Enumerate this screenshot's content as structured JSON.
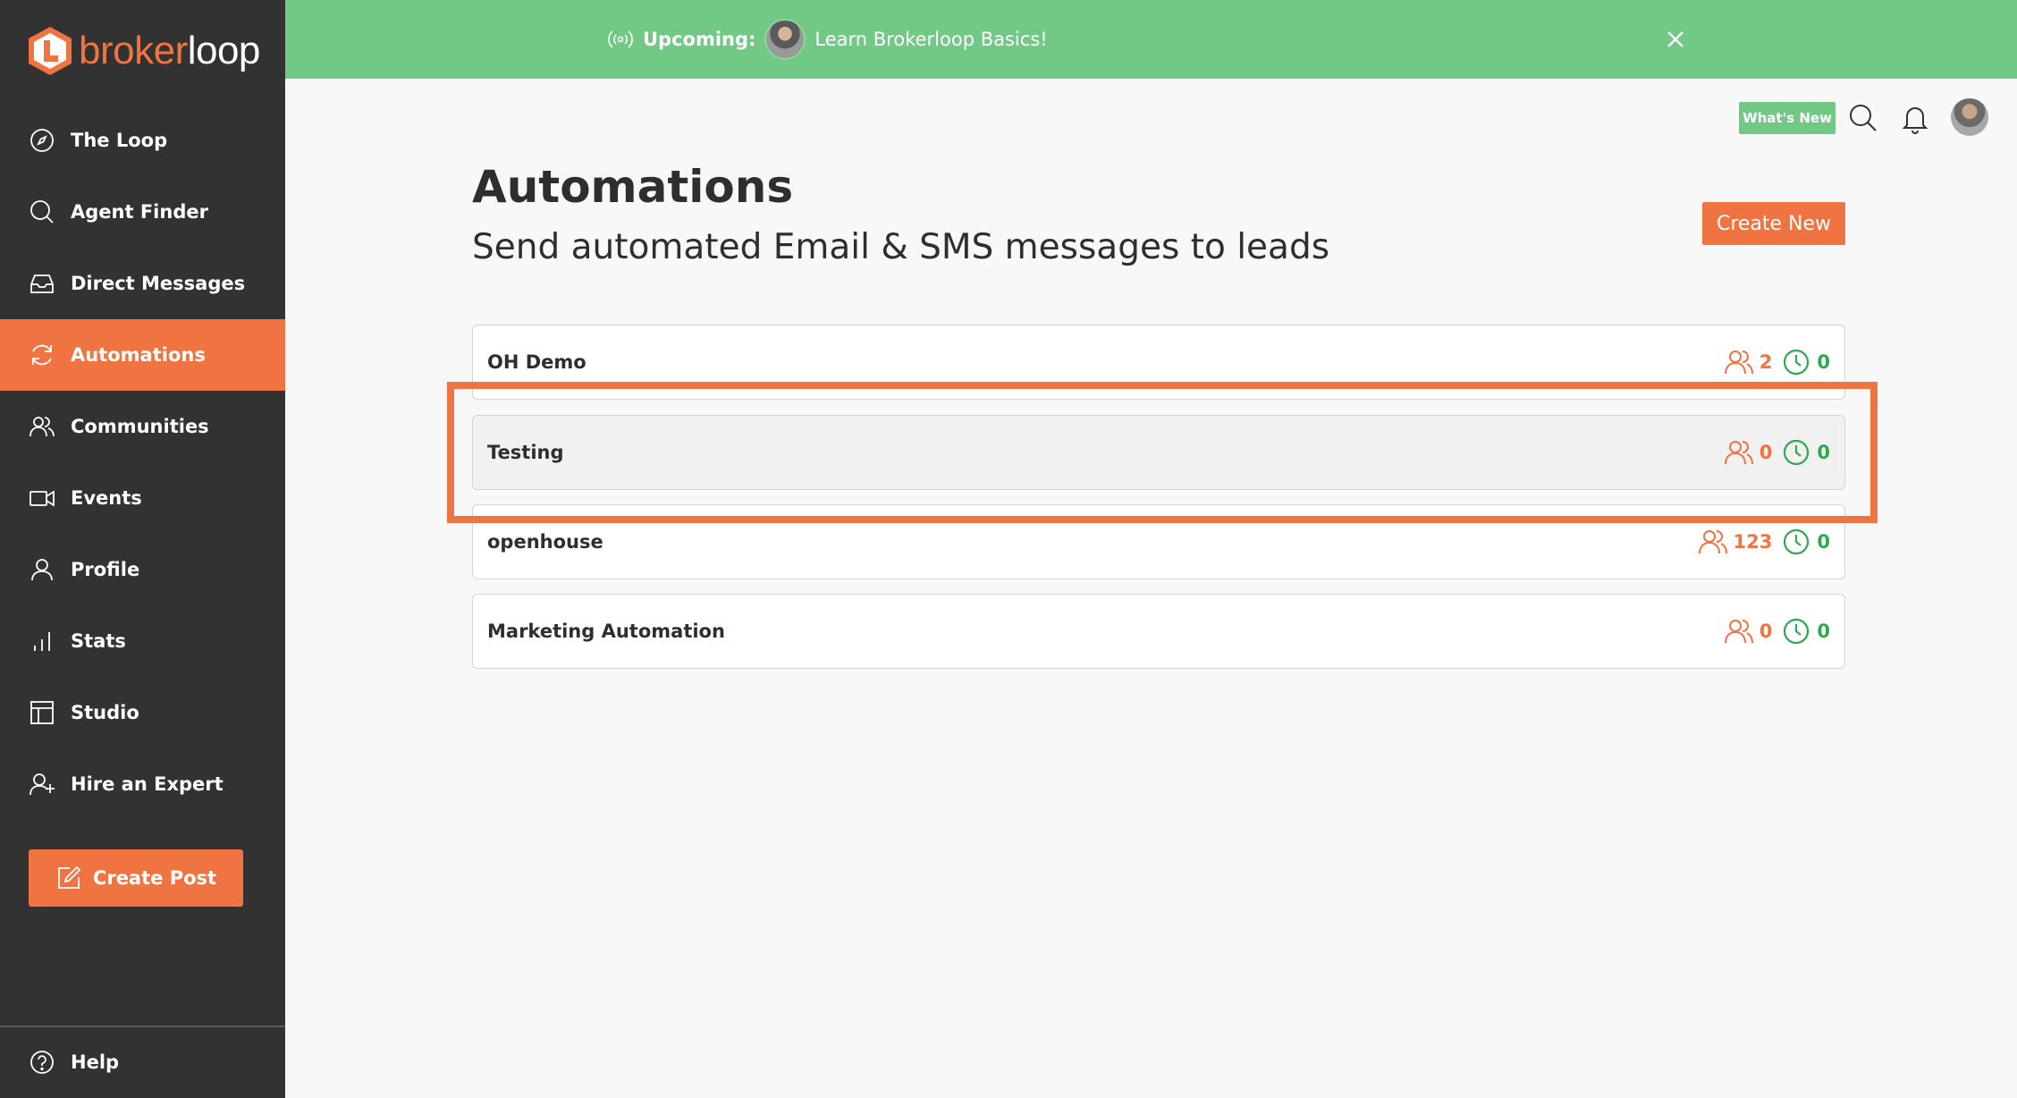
{
  "brand": {
    "part1": "broker",
    "part2": "loop",
    "accent": "#f07342"
  },
  "sidebar": {
    "items": [
      {
        "label": "The Loop",
        "icon": "compass-icon"
      },
      {
        "label": "Agent Finder",
        "icon": "search-icon"
      },
      {
        "label": "Direct Messages",
        "icon": "inbox-icon"
      },
      {
        "label": "Automations",
        "icon": "refresh-icon",
        "active": true
      },
      {
        "label": "Communities",
        "icon": "users-icon"
      },
      {
        "label": "Events",
        "icon": "video-icon"
      },
      {
        "label": "Profile",
        "icon": "user-icon"
      },
      {
        "label": "Stats",
        "icon": "bar-chart-icon"
      },
      {
        "label": "Studio",
        "icon": "layout-icon"
      },
      {
        "label": "Hire an Expert",
        "icon": "user-plus-icon"
      }
    ],
    "create_post_label": "Create Post",
    "help_label": "Help"
  },
  "banner": {
    "upcoming_label": "Upcoming:",
    "title": "Learn Brokerloop Basics!",
    "color": "#72c885"
  },
  "topbar": {
    "whats_new_label": "What's New"
  },
  "main": {
    "title": "Automations",
    "subtitle": "Send automated Email & SMS messages to leads",
    "create_new_label": "Create New",
    "automations": [
      {
        "name": "OH Demo",
        "people": "2",
        "scheduled": "0"
      },
      {
        "name": "Testing",
        "people": "0",
        "scheduled": "0"
      },
      {
        "name": "openhouse",
        "people": "123",
        "scheduled": "0"
      },
      {
        "name": "Marketing Automation",
        "people": "0",
        "scheduled": "0"
      }
    ]
  }
}
